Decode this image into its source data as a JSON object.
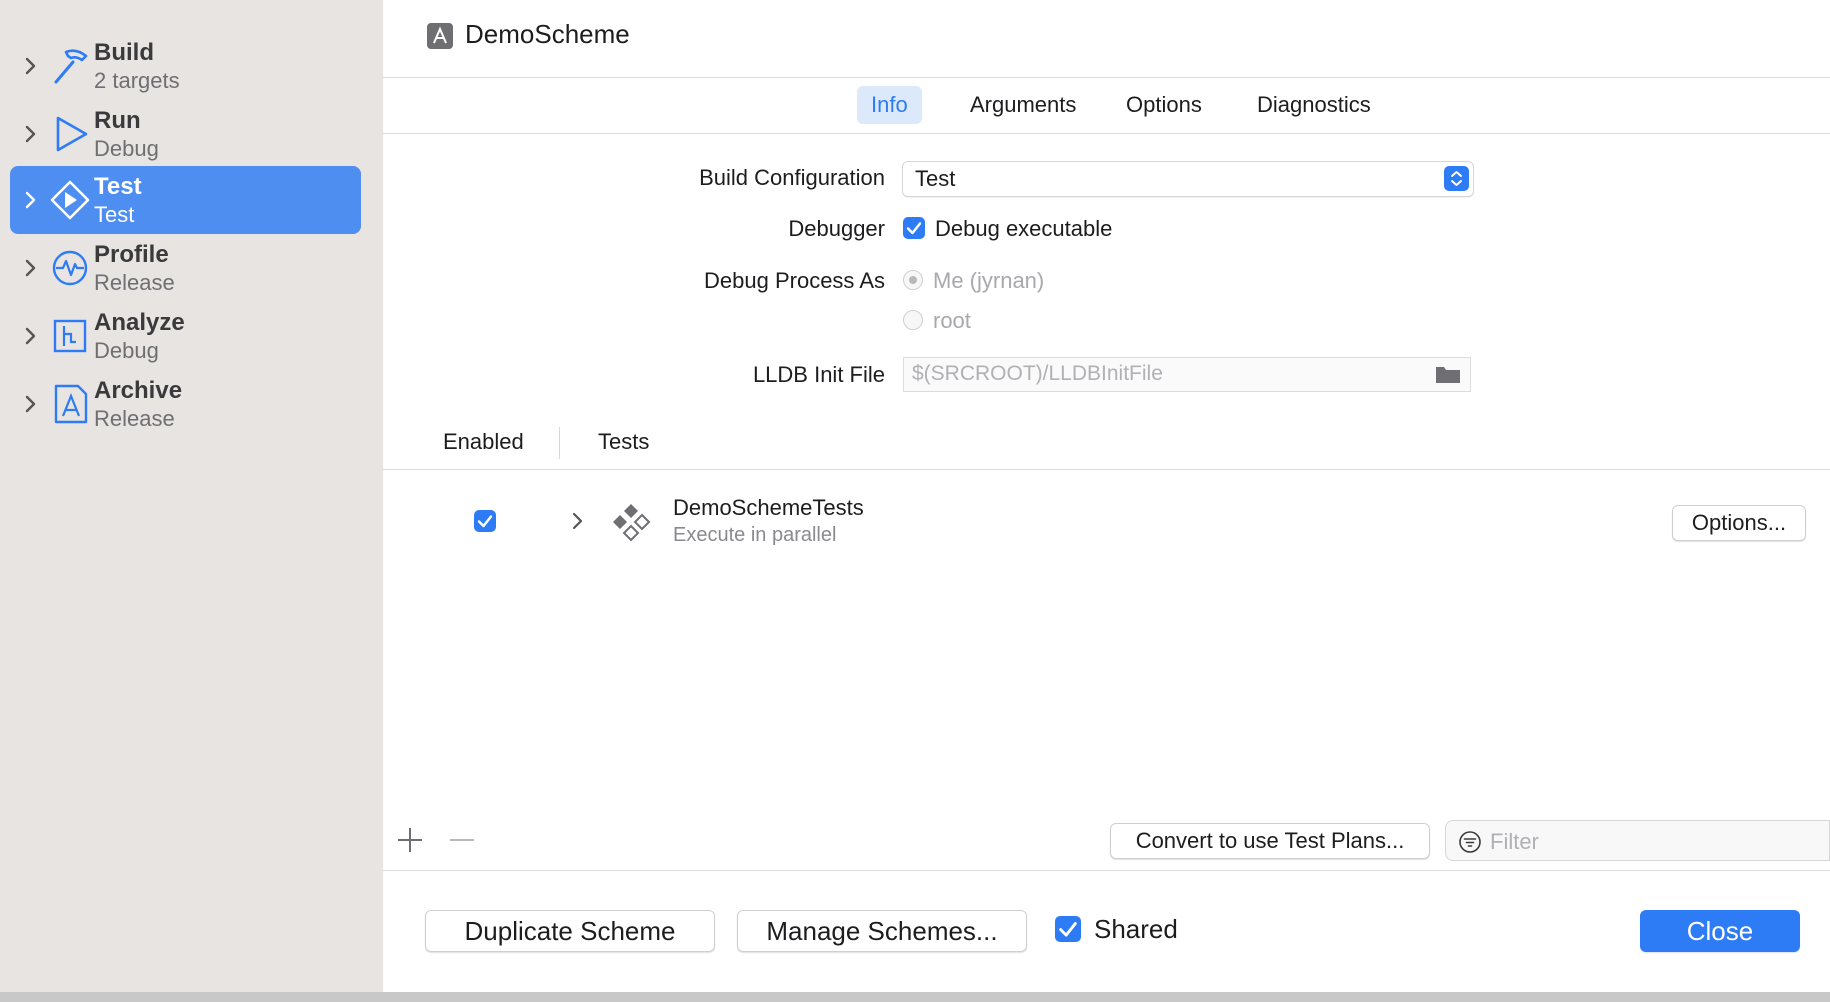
{
  "sidebar": {
    "items": [
      {
        "title": "Build",
        "subtitle": "2 targets",
        "icon": "hammer-icon"
      },
      {
        "title": "Run",
        "subtitle": "Debug",
        "icon": "play-icon"
      },
      {
        "title": "Test",
        "subtitle": "Test",
        "icon": "test-diamond-icon",
        "selected": true
      },
      {
        "title": "Profile",
        "subtitle": "Release",
        "icon": "waveform-icon"
      },
      {
        "title": "Analyze",
        "subtitle": "Debug",
        "icon": "analyze-icon"
      },
      {
        "title": "Archive",
        "subtitle": "Release",
        "icon": "archive-icon"
      }
    ]
  },
  "header": {
    "scheme_name": "DemoScheme"
  },
  "tabs": [
    {
      "label": "Info",
      "selected": true
    },
    {
      "label": "Arguments"
    },
    {
      "label": "Options"
    },
    {
      "label": "Diagnostics"
    }
  ],
  "info": {
    "build_configuration_label": "Build Configuration",
    "build_configuration_value": "Test",
    "debugger_label": "Debugger",
    "debug_executable_label": "Debug executable",
    "debug_executable_checked": true,
    "debug_process_as_label": "Debug Process As",
    "process_options": [
      {
        "label": "Me (jyrnan)",
        "selected": true,
        "disabled": true
      },
      {
        "label": "root",
        "selected": false,
        "disabled": true
      }
    ],
    "lldb_label": "LLDB Init File",
    "lldb_placeholder": "$(SRCROOT)/LLDBInitFile"
  },
  "tests_table": {
    "columns": [
      "Enabled",
      "Tests"
    ],
    "rows": [
      {
        "enabled": true,
        "name": "DemoSchemeTests",
        "detail": "Execute in parallel",
        "options_label": "Options..."
      }
    ]
  },
  "toolbar": {
    "convert_label": "Convert to use Test Plans...",
    "filter_placeholder": "Filter"
  },
  "footer": {
    "duplicate_label": "Duplicate Scheme",
    "manage_label": "Manage Schemes...",
    "shared_label": "Shared",
    "shared_checked": true,
    "close_label": "Close"
  },
  "colors": {
    "accent": "#2d7cf6",
    "sidebar_selection": "#4d8ef0",
    "sidebar_bg": "#e8e4e2"
  }
}
